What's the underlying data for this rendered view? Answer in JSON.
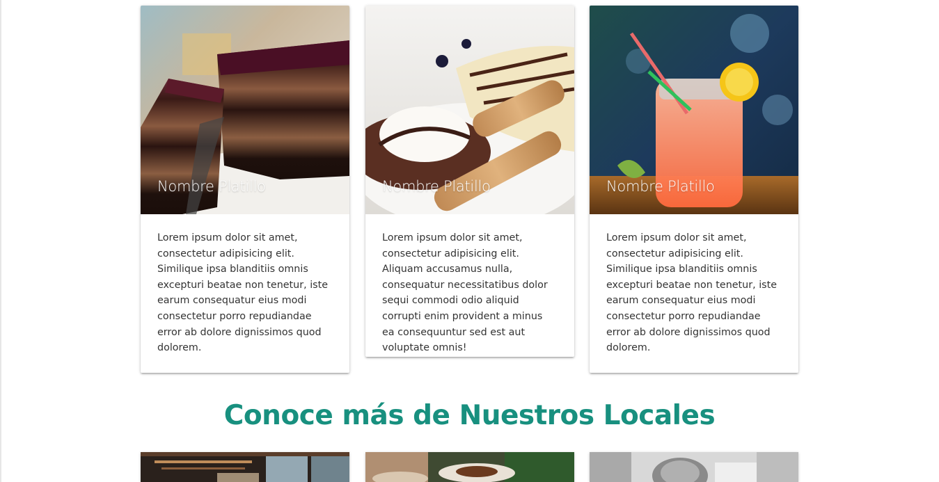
{
  "cards": [
    {
      "title": "Nombre Platillo",
      "image_icon": "chocolate-cake-photo",
      "text": "Lorem ipsum dolor sit amet, consectetur adipisicing elit. Similique ipsa blanditiis omnis excepturi beatae non tenetur, iste earum consequatur eius modi consectetur porro repudiandae error ab dolore dignissimos quod dolorem."
    },
    {
      "title": "Nombre Platillo",
      "image_icon": "wafer-dessert-photo",
      "text": "Lorem ipsum dolor sit amet, consectetur adipisicing elit. Aliquam accusamus nulla, consequatur necessitatibus dolor sequi commodi odio aliquid corrupti enim provident a minus ea consequuntur sed est aut voluptate omnis!"
    },
    {
      "title": "Nombre Platillo",
      "image_icon": "cocktail-jar-photo",
      "text": "Lorem ipsum dolor sit amet, consectetur adipisicing elit. Similique ipsa blanditiis omnis excepturi beatae non tenetur, iste earum consequatur eius modi consectetur porro repudiandae error ab dolore dignissimos quod dolorem."
    }
  ],
  "section": {
    "title": "Conoce más de Nuestros Locales"
  },
  "locales": [
    {
      "image_icon": "restaurant-bar-photo"
    },
    {
      "image_icon": "coffee-table-photo"
    },
    {
      "image_icon": "person-bw-photo"
    }
  ],
  "colors": {
    "accent": "#18907f",
    "text": "#333333",
    "card_title": "#ffffff"
  }
}
